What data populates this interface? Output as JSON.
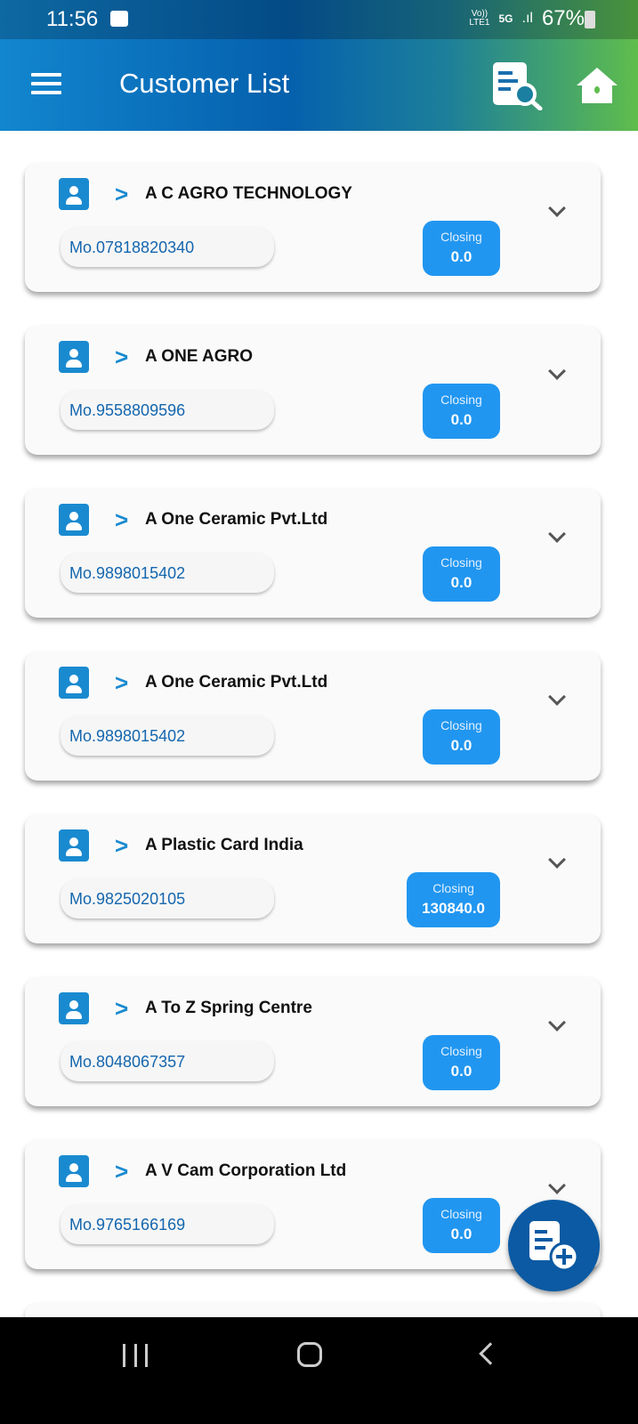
{
  "status_bar": {
    "time": "11:56",
    "network_top": "Vo))",
    "network_bottom": "LTE1",
    "five_g": "5G",
    "battery": "67%"
  },
  "header": {
    "title": "Customer List",
    "icons": [
      "menu-icon",
      "document-search-icon",
      "home-icon"
    ]
  },
  "colors": {
    "accent": "#2196f0",
    "header_start": "#1286cf",
    "header_end": "#5fbd4c",
    "fab": "#0b5aa3"
  },
  "closing_label": "Closing",
  "customers": [
    {
      "name": "A C AGRO TECHNOLOGY",
      "phone": "Mo.07818820340",
      "closing": "0.0"
    },
    {
      "name": "A ONE AGRO",
      "phone": "Mo.9558809596",
      "closing": "0.0"
    },
    {
      "name": "A One Ceramic Pvt.Ltd",
      "phone": "Mo.9898015402",
      "closing": "0.0"
    },
    {
      "name": "A One Ceramic Pvt.Ltd",
      "phone": "Mo.9898015402",
      "closing": "0.0"
    },
    {
      "name": "A Plastic Card India",
      "phone": "Mo.9825020105",
      "closing": "130840.0"
    },
    {
      "name": "A To Z Spring Centre",
      "phone": "Mo.8048067357",
      "closing": "0.0"
    },
    {
      "name": "A V Cam Corporation Ltd",
      "phone": "Mo.9765166169",
      "closing": "0.0"
    }
  ]
}
